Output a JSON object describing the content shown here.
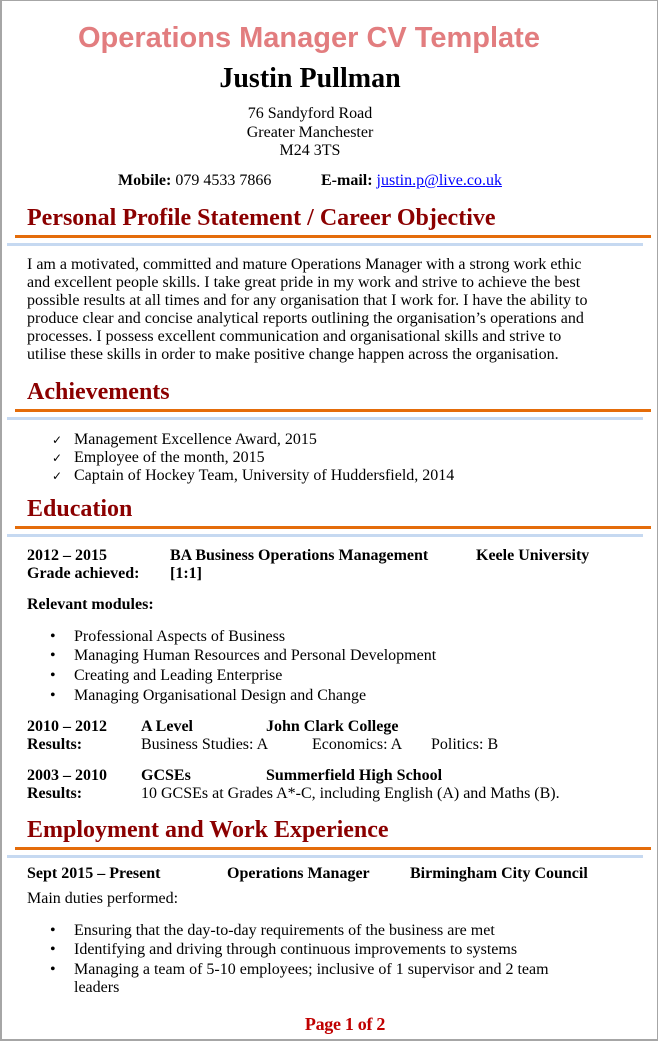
{
  "document": {
    "title": "Operations Manager CV Template",
    "page_indicator": "Page 1 of 2"
  },
  "header": {
    "name": "Justin Pullman",
    "address": [
      "76 Sandyford Road",
      "Greater Manchester",
      "M24 3TS"
    ],
    "mobile_label": "Mobile:",
    "mobile": "079 4533 7866",
    "email_label": "E-mail:",
    "email": "justin.p@live.co.uk"
  },
  "profile": {
    "heading": "Personal Profile Statement / Career Objective",
    "lines": [
      "I am a motivated, committed and mature Operations Manager with a strong work ethic",
      "and excellent people skills. I take great pride in my work and strive to achieve the best",
      "possible results at all times and for any organisation  that I work for. I have the ability to",
      "produce clear and concise analytical reports outlining the organisation’s  operations and",
      "processes. I possess excellent communication  and organisational  skills  and strive to",
      "utilise these skills  in order to make positive change happen across the organisation."
    ]
  },
  "achievements": {
    "heading": "Achievements",
    "icon": "checkmark-icon",
    "items": [
      "Management Excellence Award, 2015",
      "Employee of the month, 2015",
      "Captain of Hockey Team, University of Huddersfield, 2014"
    ]
  },
  "education": {
    "heading": "Education",
    "degree": {
      "dates": "2012 – 2015",
      "title": "BA Business Operations Management",
      "institution": "Keele University",
      "grade_label": "Grade achieved:",
      "grade": "[1:1]",
      "modules_label": "Relevant modules:",
      "modules": [
        "Professional Aspects of Business",
        "Managing Human Resources and Personal Development",
        "Creating and Leading Enterprise",
        "Managing Organisational Design and Change"
      ]
    },
    "a_level": {
      "dates": "2010 – 2012",
      "title": "A Level",
      "institution": "John Clark College",
      "results_label": "Results:",
      "results": [
        "Business Studies: A",
        "Economics: A",
        "Politics: B"
      ]
    },
    "gcse": {
      "dates": "2003 – 2010",
      "title": "GCSEs",
      "institution": "Summerfield High School",
      "results_label": "Results:",
      "results": "10 GCSEs at Grades A*-C, including English (A) and Maths (B)."
    }
  },
  "employment": {
    "heading": "Employment and Work Experience",
    "jobs": [
      {
        "dates": "Sept 2015 – Present",
        "title": "Operations Manager",
        "employer": "Birmingham City Council",
        "duties_label": "Main duties performed:",
        "duties": [
          "Ensuring that the day-to-day requirements of the business are met",
          "Identifying and driving through continuous improvements to systems",
          "Managing a team of 5-10 employees; inclusive  of 1 supervisor and 2 team leaders"
        ]
      }
    ]
  },
  "symbols": {
    "check": "✓",
    "bullet": "•"
  },
  "colors": {
    "title": "#E27D7F",
    "heading": "#8B0000",
    "rule_orange": "#E46C0A",
    "rule_blue": "#C6D9F1",
    "link": "#0000FF",
    "page_indicator": "#C00000"
  }
}
